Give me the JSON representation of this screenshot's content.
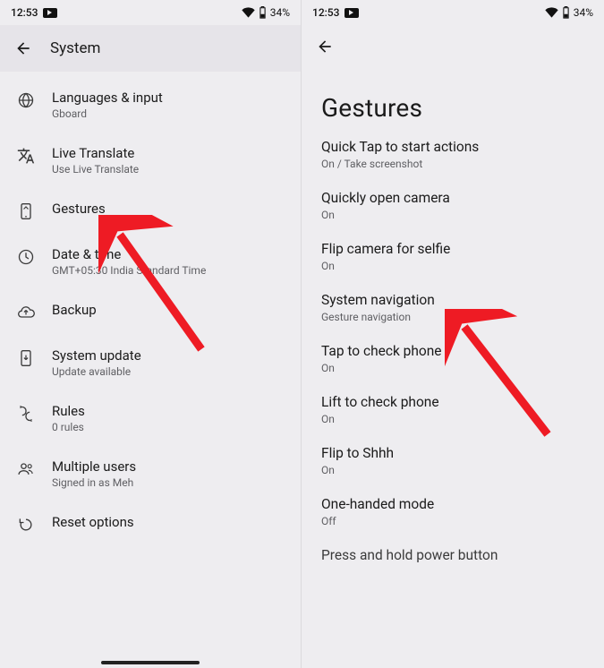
{
  "status": {
    "time": "12:53",
    "battery_pct": "34%"
  },
  "left": {
    "header_title": "System",
    "items": [
      {
        "title": "Languages & input",
        "sub": "Gboard"
      },
      {
        "title": "Live Translate",
        "sub": "Use Live Translate"
      },
      {
        "title": "Gestures",
        "sub": ""
      },
      {
        "title": "Date & time",
        "sub": "GMT+05:30 India Standard Time"
      },
      {
        "title": "Backup",
        "sub": ""
      },
      {
        "title": "System update",
        "sub": "Update available"
      },
      {
        "title": "Rules",
        "sub": "0 rules"
      },
      {
        "title": "Multiple users",
        "sub": "Signed in as Meh"
      },
      {
        "title": "Reset options",
        "sub": ""
      }
    ]
  },
  "right": {
    "page_title": "Gestures",
    "items": [
      {
        "title": "Quick Tap to start actions",
        "sub": "On / Take screenshot"
      },
      {
        "title": "Quickly open camera",
        "sub": "On"
      },
      {
        "title": "Flip camera for selfie",
        "sub": "On"
      },
      {
        "title": "System navigation",
        "sub": "Gesture navigation"
      },
      {
        "title": "Tap to check phone",
        "sub": "On"
      },
      {
        "title": "Lift to check phone",
        "sub": "On"
      },
      {
        "title": "Flip to Shhh",
        "sub": "On"
      },
      {
        "title": "One-handed mode",
        "sub": "Off"
      },
      {
        "title": "Press and hold power button",
        "sub": ""
      }
    ]
  }
}
